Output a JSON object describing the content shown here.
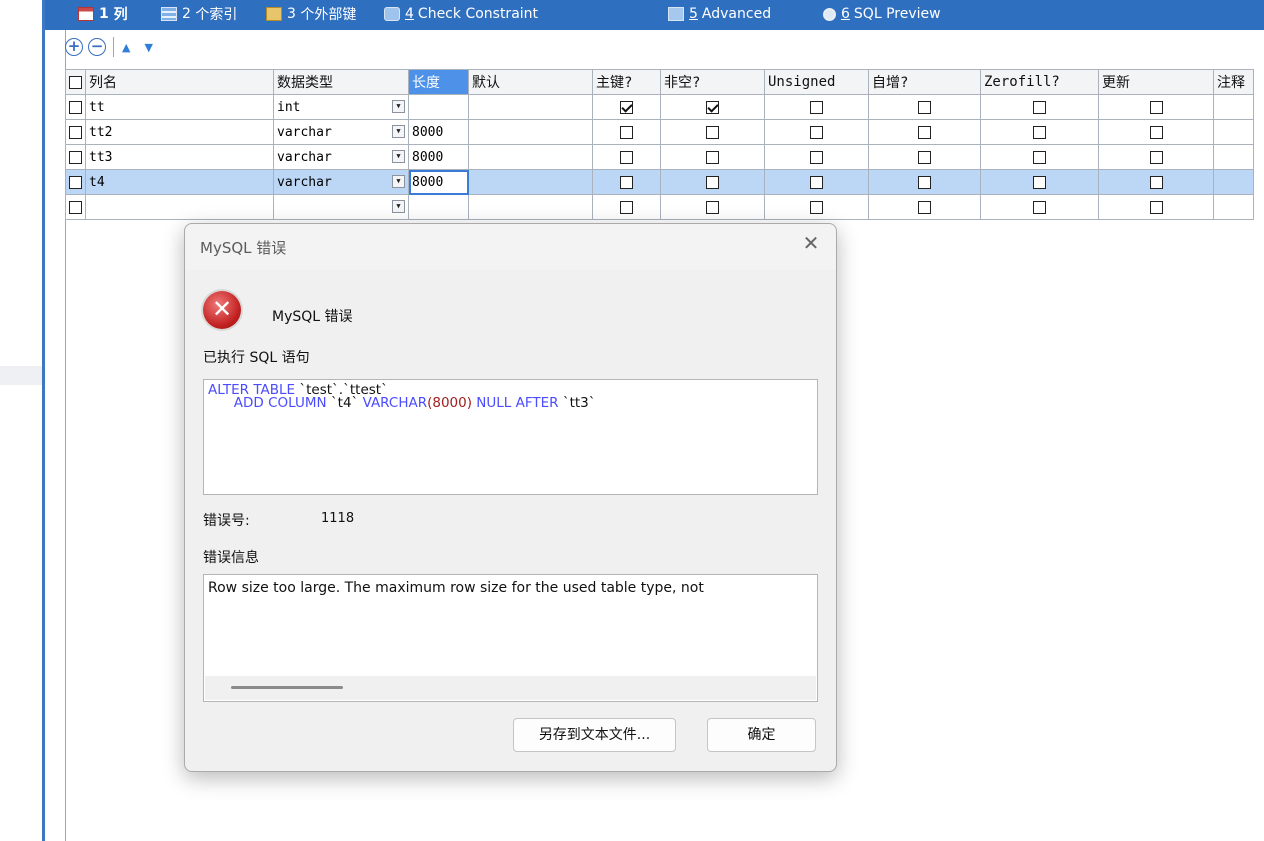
{
  "tabs": [
    {
      "num": "1",
      "label": "列",
      "mnemonic": false
    },
    {
      "num": "2",
      "label": "个索引",
      "mnemonic": false
    },
    {
      "num": "3",
      "label": "个外部键",
      "mnemonic": false
    },
    {
      "num": "4",
      "label": "Check Constraint",
      "mnemonic": true
    },
    {
      "num": "5",
      "label": "Advanced",
      "mnemonic": true
    },
    {
      "num": "6",
      "label": "SQL Preview",
      "mnemonic": true
    }
  ],
  "toolbar": {
    "add_icon": "plus-circle-icon",
    "remove_icon": "minus-circle-icon",
    "up_icon": "triangle-up-icon",
    "down_icon": "triangle-down-icon"
  },
  "grid": {
    "headers": [
      "列名",
      "数据类型",
      "长度",
      "默认",
      "主键?",
      "非空?",
      "Unsigned",
      "自增?",
      "Zerofill?",
      "更新",
      "注释"
    ],
    "rows": [
      {
        "name": "tt",
        "type": "int",
        "length": "",
        "default": "",
        "checks": [
          true,
          true,
          false,
          false,
          false,
          false
        ]
      },
      {
        "name": "tt2",
        "type": "varchar",
        "length": "8000",
        "default": "",
        "checks": [
          false,
          false,
          false,
          false,
          false,
          false
        ]
      },
      {
        "name": "tt3",
        "type": "varchar",
        "length": "8000",
        "default": "",
        "checks": [
          false,
          false,
          false,
          false,
          false,
          false
        ]
      },
      {
        "name": "t4",
        "type": "varchar",
        "length": "8000",
        "default": "",
        "checks": [
          false,
          false,
          false,
          false,
          false,
          false
        ]
      },
      {
        "name": "",
        "type": "",
        "length": "",
        "default": "",
        "checks": [
          false,
          false,
          false,
          false,
          false,
          false
        ]
      }
    ]
  },
  "dialog": {
    "title": "MySQL 错误",
    "close": "✕",
    "header_message": "MySQL 错误",
    "sql_label": "已执行 SQL 语句",
    "sql": {
      "kw_alter": "ALTER TABLE",
      "table_ref": " `test`.`ttest`",
      "indent": "      ",
      "kw_add": "ADD COLUMN",
      "col": " `t4` ",
      "kw_varchar": "VARCHAR",
      "paren_open": "(",
      "len": "8000",
      "paren_close": ") ",
      "kw_null": "NULL AFTER",
      "after_col": " `tt3`"
    },
    "errno_label": "错误号:",
    "errno": "1118",
    "errmsg_label": "错误信息",
    "errmsg": "Row size too large. The maximum row size for the used table type, not",
    "buttons": {
      "save": "另存到文本文件...",
      "ok": "确定"
    },
    "icon": "error-x-icon"
  }
}
